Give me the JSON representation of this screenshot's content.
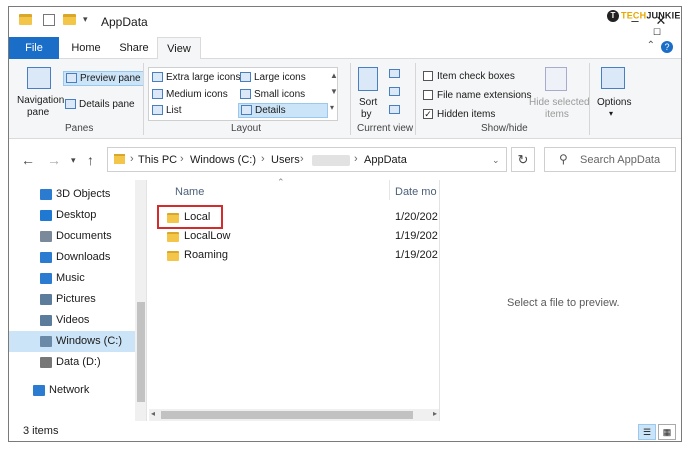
{
  "window": {
    "title": "AppData"
  },
  "watermark": {
    "part1": "TECH",
    "part2": "JUNKIE",
    "badge": "T"
  },
  "ribbon_tabs": [
    "File",
    "Home",
    "Share",
    "View"
  ],
  "ribbon": {
    "panes": {
      "navigation_pane": "Navigation",
      "navigation_pane_2": "pane",
      "preview_pane": "Preview pane",
      "details_pane": "Details pane",
      "group_label": "Panes"
    },
    "layout": {
      "extra_large_icons": "Extra large icons",
      "large_icons": "Large icons",
      "medium_icons": "Medium icons",
      "small_icons": "Small icons",
      "list": "List",
      "details": "Details",
      "group_label": "Layout"
    },
    "current_view": {
      "sort_by": "Sort",
      "sort_by_2": "by",
      "group_label": "Current view"
    },
    "show_hide": {
      "item_check_boxes": "Item check boxes",
      "file_name_extensions": "File name extensions",
      "hidden_items": "Hidden items",
      "hide_selected_items": "Hide selected",
      "hide_selected_items_2": "items",
      "group_label": "Show/hide",
      "checked": {
        "item_check_boxes": false,
        "file_name_extensions": false,
        "hidden_items": true
      }
    },
    "options": {
      "label": "Options"
    }
  },
  "address": {
    "crumbs": [
      "This PC",
      "Windows (C:)",
      "Users",
      "AppData"
    ],
    "search_placeholder": "Search AppData"
  },
  "nav_items": [
    {
      "label": "3D Objects",
      "icon": "3d-objects-icon",
      "color": "#2b7bd1"
    },
    {
      "label": "Desktop",
      "icon": "desktop-icon",
      "color": "#1f78d1"
    },
    {
      "label": "Documents",
      "icon": "documents-icon",
      "color": "#7a8a9a"
    },
    {
      "label": "Downloads",
      "icon": "downloads-icon",
      "color": "#2b7bd1"
    },
    {
      "label": "Music",
      "icon": "music-icon",
      "color": "#2b7bd1"
    },
    {
      "label": "Pictures",
      "icon": "pictures-icon",
      "color": "#5c7c9c"
    },
    {
      "label": "Videos",
      "icon": "videos-icon",
      "color": "#5c7c9c"
    },
    {
      "label": "Windows (C:)",
      "icon": "drive-c-icon",
      "color": "#6a8aa8",
      "selected": true
    },
    {
      "label": "Data (D:)",
      "icon": "drive-d-icon",
      "color": "#777777"
    },
    {
      "label": "Network",
      "icon": "network-icon",
      "color": "#2b7bd1"
    }
  ],
  "columns": {
    "name": "Name",
    "date": "Date mo"
  },
  "files": [
    {
      "name": "Local",
      "date": "1/20/202"
    },
    {
      "name": "LocalLow",
      "date": "1/19/202"
    },
    {
      "name": "Roaming",
      "date": "1/19/202"
    }
  ],
  "preview": {
    "message": "Select a file to preview."
  },
  "status": {
    "count": "3 items"
  },
  "colors": {
    "accent": "#1a6ec7",
    "selection": "#cce4f7",
    "highlight_box": "#d22c2c",
    "folder": "#f3c64a"
  }
}
